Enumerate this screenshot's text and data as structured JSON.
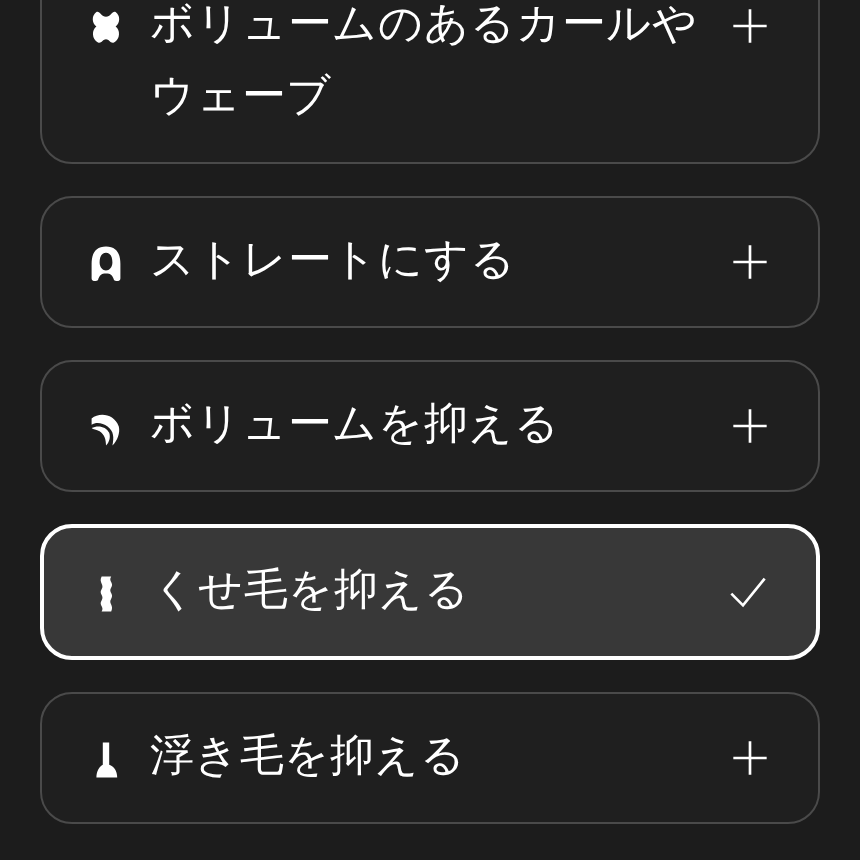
{
  "options": [
    {
      "label": "ボリュームのあるカールやウェーブ",
      "selected": false
    },
    {
      "label": "ストレートにする",
      "selected": false
    },
    {
      "label": "ボリュームを抑える",
      "selected": false
    },
    {
      "label": "くせ毛を抑える",
      "selected": true
    },
    {
      "label": "浮き毛を抑える",
      "selected": false
    }
  ]
}
